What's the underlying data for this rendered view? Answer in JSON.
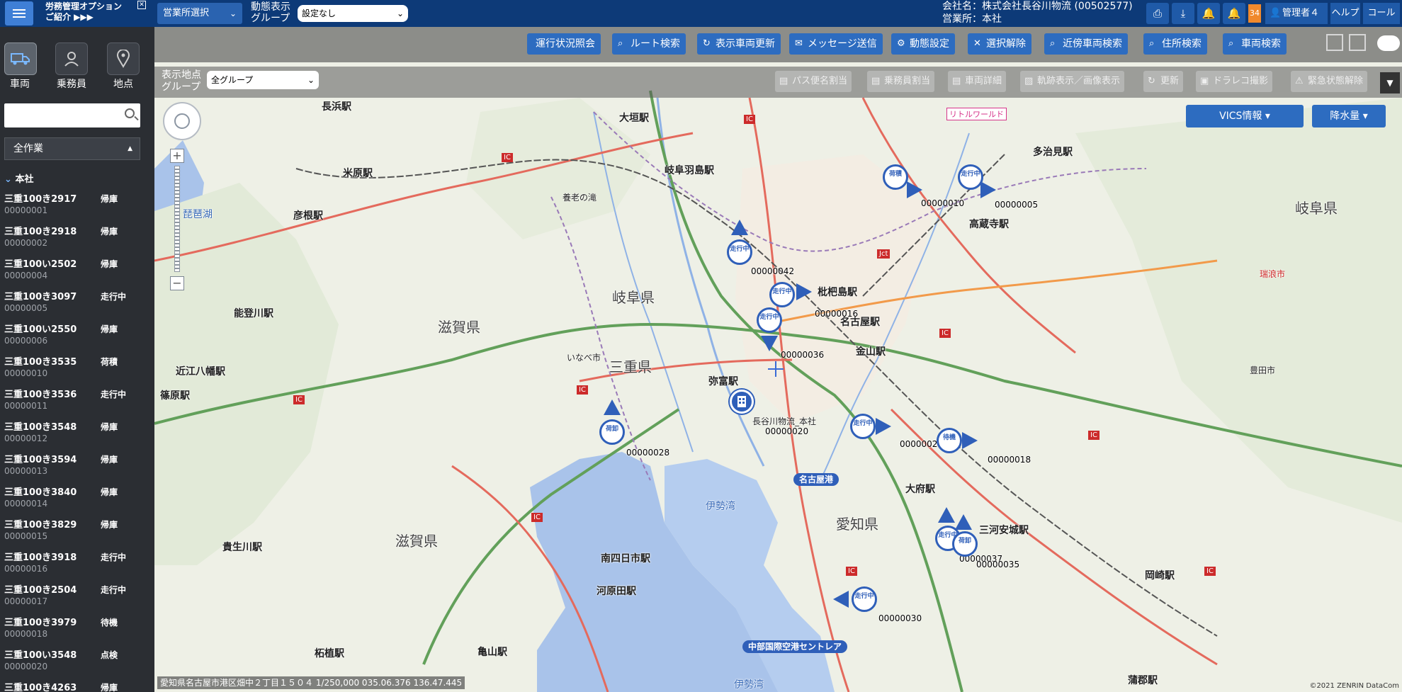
{
  "header": {
    "promo_line1": "労務管理オプション",
    "promo_line2": "ご紹介 ▶▶▶",
    "promo_close": "✕",
    "office_select": "営業所選択",
    "group_label_1": "動態表示",
    "group_label_2": "グループ",
    "group_select": "設定なし",
    "company": "会社名：株式会社長谷川物流 (00502577)",
    "office": "営業所：本社",
    "badge_count": "34",
    "user": "管理者４",
    "help": "ヘルプ",
    "control": "コール"
  },
  "sidebar": {
    "tabs": [
      {
        "label": "車両"
      },
      {
        "label": "乗務員"
      },
      {
        "label": "地点"
      }
    ],
    "search_placeholder": "",
    "work_filter": "全作業",
    "group_name": "本社",
    "vehicles": [
      {
        "plate": "三重100き2917",
        "status": "帰庫",
        "id": "00000001"
      },
      {
        "plate": "三重100き2918",
        "status": "帰庫",
        "id": "00000002"
      },
      {
        "plate": "三重100い2502",
        "status": "帰庫",
        "id": "00000004"
      },
      {
        "plate": "三重100き3097",
        "status": "走行中",
        "id": "00000005"
      },
      {
        "plate": "三重100い2550",
        "status": "帰庫",
        "id": "00000006"
      },
      {
        "plate": "三重100き3535",
        "status": "荷積",
        "id": "00000010"
      },
      {
        "plate": "三重100き3536",
        "status": "走行中",
        "id": "00000011"
      },
      {
        "plate": "三重100き3548",
        "status": "帰庫",
        "id": "00000012"
      },
      {
        "plate": "三重100き3594",
        "status": "帰庫",
        "id": "00000013"
      },
      {
        "plate": "三重100き3840",
        "status": "帰庫",
        "id": "00000014"
      },
      {
        "plate": "三重100き3829",
        "status": "帰庫",
        "id": "00000015"
      },
      {
        "plate": "三重100き3918",
        "status": "走行中",
        "id": "00000016"
      },
      {
        "plate": "三重100き2504",
        "status": "走行中",
        "id": "00000017"
      },
      {
        "plate": "三重100き3979",
        "status": "待機",
        "id": "00000018"
      },
      {
        "plate": "三重100い3548",
        "status": "点検",
        "id": "00000020"
      },
      {
        "plate": "三重100き4263",
        "status": "帰庫",
        "id": ""
      }
    ]
  },
  "toolbar": {
    "buttons": [
      "運行状況照会",
      "ルート検索",
      "表示車両更新",
      "メッセージ送信",
      "動態設定",
      "選択解除",
      "近傍車両検索",
      "住所検索",
      "車両検索"
    ],
    "location_label_1": "表示地点",
    "location_label_2": "グループ",
    "location_select": "全グループ",
    "secondary_buttons": [
      "パス便名割当",
      "乗務員割当",
      "車両詳細",
      "軌跡表示／画像表示",
      "更新",
      "ドラレコ撮影",
      "緊急状態解除"
    ],
    "more": "▼",
    "vics": "VICS情報",
    "rain": "降水量"
  },
  "map": {
    "status": "愛知県名古屋市港区畑中２丁目１５０４ 1/250,000 035.06.376 136.47.445",
    "copyright": "©2021 ZENRIN DataCom",
    "labels": {
      "nagahama": "長浜駅",
      "ogaki": "大垣駅",
      "gifuhashima": "岐阜羽島駅",
      "tajimi": "多治見駅",
      "kozoji": "高蔵寺駅",
      "hikone": "彦根駅",
      "maibara": "米原駅",
      "notogawa": "能登川駅",
      "omihachiman": "近江八幡駅",
      "shinohara": "篠原駅",
      "biwako": "琵琶湖",
      "gifu_pref": "岐阜県",
      "shiga_pref": "滋賀県",
      "mie_pref": "三重県",
      "aichi_pref": "愛知県",
      "gifu_pref2": "岐阜県",
      "shiga_pref2": "滋賀県",
      "biwajima": "枇杷島駅",
      "nagoya": "名古屋駅",
      "kanayama": "金山駅",
      "yatomi": "弥富駅",
      "obu": "大府駅",
      "mikawaanjo": "三河安城駅",
      "okazaki": "岡崎駅",
      "yokkaichi": "南四日市駅",
      "kawarada": "河原田駅",
      "kameyama": "亀山駅",
      "tsuge": "柘植駅",
      "kibukawa": "貴生川駅",
      "gamagori": "蒲郡駅",
      "ise_bay": "伊勢湾",
      "ise_bay2": "伊勢湾",
      "nagoya_port": "名古屋港",
      "centrair": "中部国際空港セントレア",
      "hq_label": "長谷川物流_本社",
      "ritoru": "リトルワールド",
      "yoro": "養老の滝",
      "inabe": "いなべ市",
      "toyota": "豊田市",
      "mizunami": "瑞浪市"
    },
    "vehicle_labels": [
      "00000042",
      "00000016",
      "00000036",
      "00000010",
      "00000005",
      "00000020",
      "00000028",
      "00000024",
      "00000018",
      "00000037",
      "00000035",
      "00000030"
    ],
    "markers": {
      "m1": "走行中",
      "m2": "走行中",
      "m3": "走行中",
      "m4": "荷積",
      "m5": "走行中",
      "m6": "荷卸",
      "m7": "走行中",
      "m8": "待機",
      "m9": "走行中",
      "m10": "荷卸",
      "m11": "走行中"
    }
  },
  "colors": {
    "header_bg": "#0d3a78",
    "button_blue": "#2d6cc0",
    "sidebar_bg": "#2b2e33",
    "marker_blue": "#2f5fb9",
    "badge_orange": "#f0892c",
    "water": "#a9c3ea"
  }
}
